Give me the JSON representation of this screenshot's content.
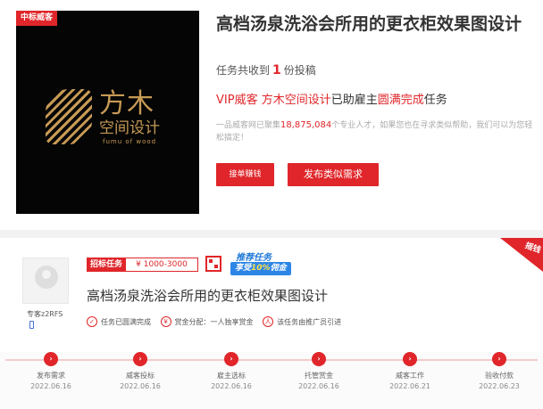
{
  "cover": {
    "badge": "中标威客",
    "logo_main": "方木",
    "logo_sub": "空间设计",
    "logo_en": "fumu  of  wood"
  },
  "task": {
    "title": "高档汤泉洗浴会所用的更衣柜效果图设计",
    "received_prefix": "任务共收到",
    "received_count": "1",
    "received_suffix": "份投稿",
    "vip_label": "VIP威客",
    "vip_name": "方木空间设计",
    "vip_mid": "已助雇主",
    "vip_status": "圆满完成",
    "vip_end": "任务",
    "desc_pre": "一品威客网已聚集",
    "desc_num": "18,875,084",
    "desc_post": "个专业人才，如果您也在寻求类似帮助，我们可以为您轻松搞定！",
    "btn_accept": "接单赚钱",
    "btn_publish": "发布类似需求"
  },
  "detail": {
    "username": "专客z2RFS",
    "tag": "招标任务",
    "price": "¥ 1000-3000",
    "promo_l1": "推荐任务",
    "promo_l2a": "享受",
    "promo_l2b": "10%",
    "promo_l2c": "佣金",
    "title": "高档汤泉洗浴会所用的更衣柜效果图设计",
    "features": [
      {
        "icon": "check-icon",
        "text": "任务已圆满完成"
      },
      {
        "icon": "yen-icon",
        "text": "赏金分配：一人独享赏金"
      },
      {
        "icon": "user-icon",
        "text": "该任务由推广员引进"
      }
    ],
    "corner": "摇钱"
  },
  "timeline": [
    {
      "label": "发布需求",
      "date": "2022.06.16"
    },
    {
      "label": "威客投标",
      "date": "2022.06.16"
    },
    {
      "label": "雇主选标",
      "date": "2022.06.16"
    },
    {
      "label": "托管赏金",
      "date": "2022.06.16"
    },
    {
      "label": "威客工作",
      "date": "2022.06.21"
    },
    {
      "label": "验收付款",
      "date": "2022.06.23"
    }
  ]
}
